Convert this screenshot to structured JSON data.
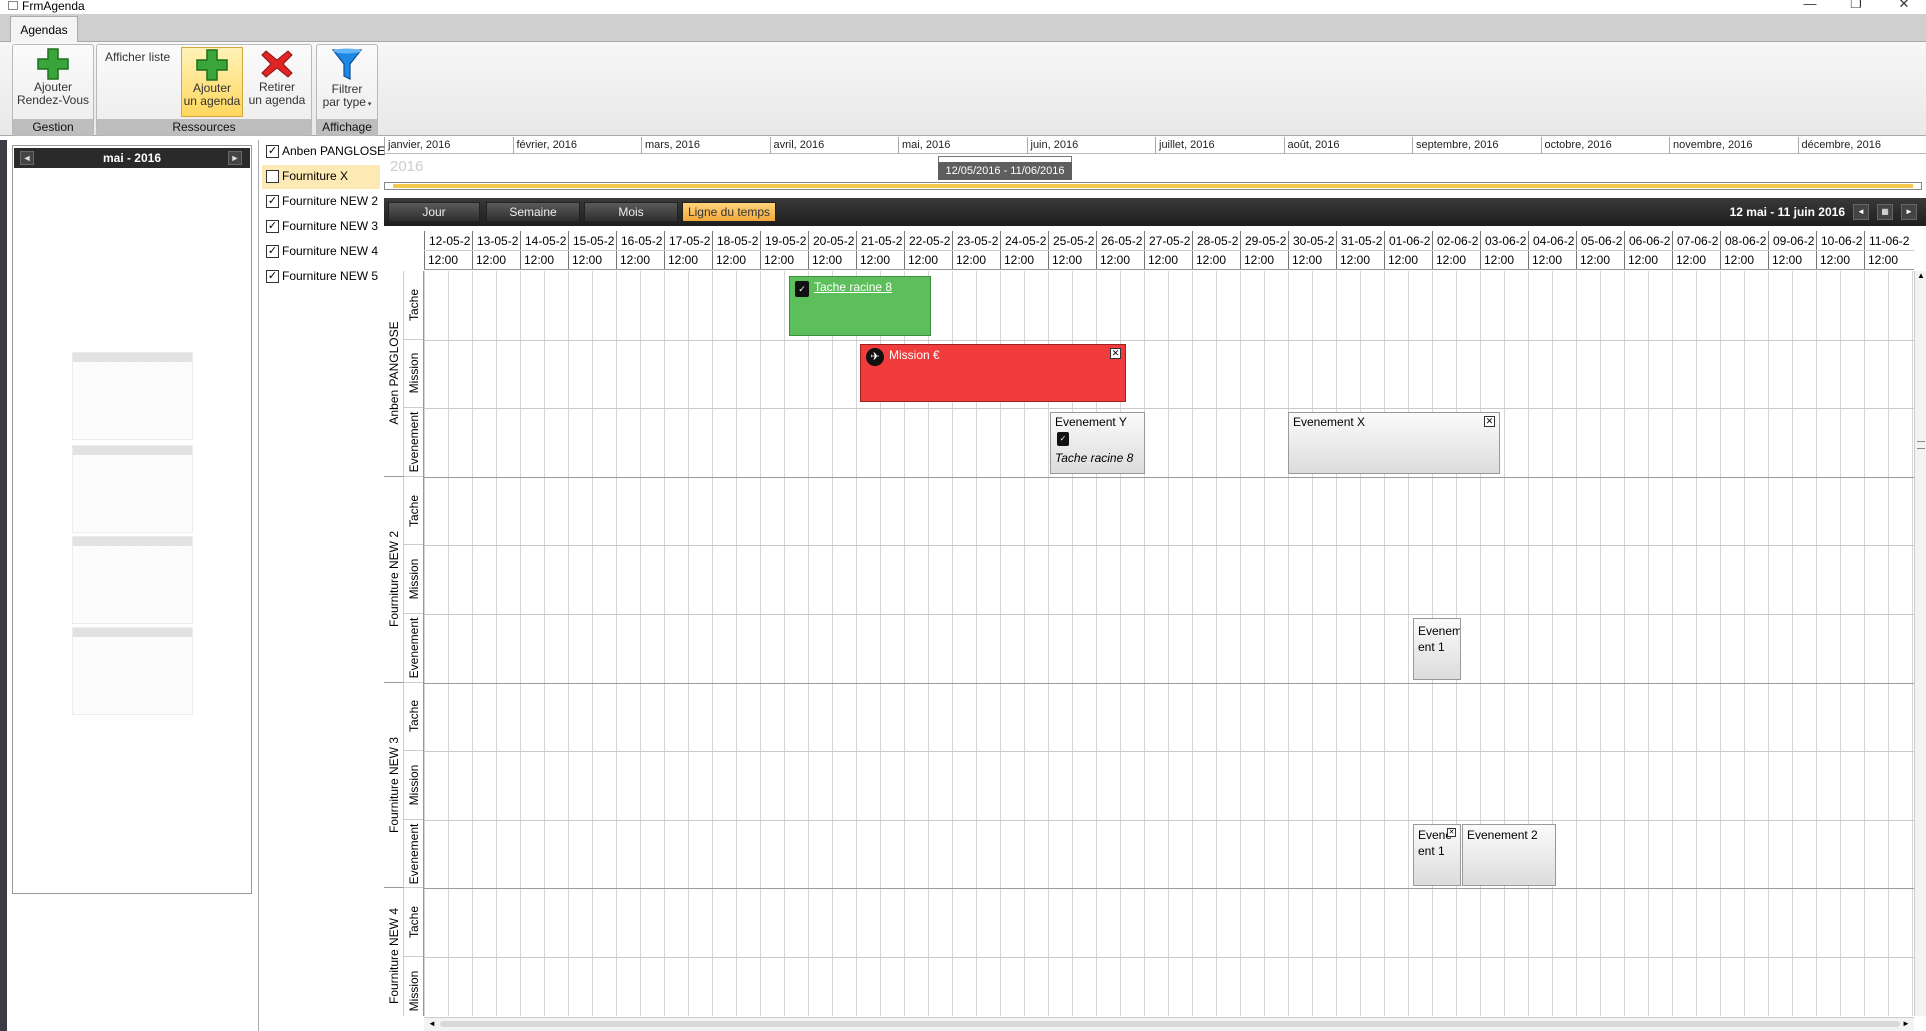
{
  "window": {
    "title": "FrmAgenda",
    "minimize": "—",
    "restore": "❐",
    "close": "✕"
  },
  "tabs": [
    {
      "label": "Agendas"
    }
  ],
  "ribbon": {
    "groups": [
      {
        "label": "Gestion",
        "buttons": [
          {
            "line1": "Ajouter",
            "line2": "Rendez-Vous"
          }
        ]
      },
      {
        "label": "Ressources",
        "list_label": "Afficher liste",
        "buttons": [
          {
            "line1": "Ajouter",
            "line2": "un agenda"
          },
          {
            "line1": "Retirer",
            "line2": "un agenda"
          }
        ]
      },
      {
        "label": "Affichage",
        "buttons": [
          {
            "line1": "Filtrer",
            "line2": "par type"
          }
        ]
      }
    ]
  },
  "mini_calendar": {
    "month_label": "mai - 2016",
    "prev": "◄",
    "next": "►"
  },
  "resources": [
    {
      "label": "Anben PANGLOSE",
      "checked": true
    },
    {
      "label": "Fourniture X",
      "checked": false
    },
    {
      "label": "Fourniture NEW 2",
      "checked": true
    },
    {
      "label": "Fourniture NEW 3",
      "checked": true
    },
    {
      "label": "Fourniture NEW 4",
      "checked": true
    },
    {
      "label": "Fourniture NEW 5",
      "checked": true
    }
  ],
  "month_bar": [
    "janvier, 2016",
    "février, 2016",
    "mars, 2016",
    "avril, 2016",
    "mai, 2016",
    "juin, 2016",
    "juillet, 2016",
    "août, 2016",
    "septembre, 2016",
    "octobre, 2016",
    "novembre, 2016",
    "décembre, 2016"
  ],
  "year_label": "2016",
  "range_label": "12/05/2016 - 11/06/2016",
  "views": [
    "Jour",
    "Semaine",
    "Mois",
    "Ligne du temps"
  ],
  "selected_view": "Ligne du temps",
  "period_label": "12 mai - 11 juin 2016",
  "days": [
    "12-05-2",
    "13-05-2",
    "14-05-2",
    "15-05-2",
    "16-05-2",
    "17-05-2",
    "18-05-2",
    "19-05-2",
    "20-05-2",
    "21-05-2",
    "22-05-2",
    "23-05-2",
    "24-05-2",
    "25-05-2",
    "26-05-2",
    "27-05-2",
    "28-05-2",
    "29-05-2",
    "30-05-2",
    "31-05-2",
    "01-06-2",
    "02-06-2",
    "03-06-2",
    "04-06-2",
    "05-06-2",
    "06-06-2",
    "07-06-2",
    "08-06-2",
    "09-06-2",
    "10-06-2",
    "11-06-2"
  ],
  "hour_label": "12:00",
  "row_groups": [
    {
      "resource": "Anben PANGLOSE",
      "types": [
        "Tache",
        "Mission",
        "Evenement"
      ]
    },
    {
      "resource": "Fourniture NEW 2",
      "types": [
        "Tache",
        "Mission",
        "Evenement"
      ]
    },
    {
      "resource": "Fourniture NEW 3",
      "types": [
        "Tache",
        "Mission",
        "Evenement"
      ]
    },
    {
      "resource": "Fourniture NEW 4",
      "types": [
        "Tache",
        "Mission"
      ]
    }
  ],
  "appointments": {
    "tache_racine": {
      "title": "Tache racine 8",
      "color": "#5cbf5c"
    },
    "mission": {
      "title": "Mission €",
      "color": "#f03c3c"
    },
    "evenement_y": {
      "title": "Evenement Y",
      "sub": "Tache racine 8"
    },
    "evenement_x": {
      "title": "Evenement X"
    },
    "evenement_1a": {
      "line1": "Evenem",
      "line2": "ent 1"
    },
    "evenement_1b": {
      "line1": "Evene",
      "line2": "ent 1"
    },
    "evenement_2": {
      "title": "Evenement 2"
    }
  },
  "colors": {
    "accent": "#f3a93a",
    "dark": "#2a2a2a",
    "highlight": "#fde9b4"
  }
}
